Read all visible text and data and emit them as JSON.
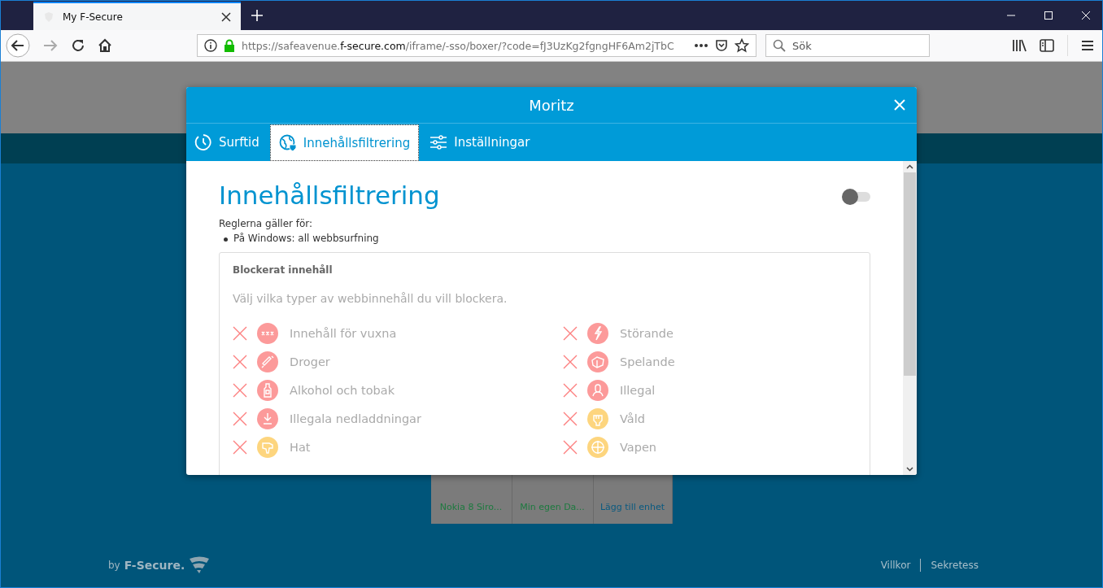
{
  "browser": {
    "tab": {
      "title": "My F-Secure"
    },
    "url": {
      "host_prefix": "https://safeavenue.",
      "host": "f-secure.com",
      "path": "/iframe/-sso/boxer/?code=fJ3UzKg2fgngHF6Am2jTbC"
    },
    "search": {
      "placeholder": "Sök"
    }
  },
  "page": {
    "devices": [
      "Nokia 8 Siro...",
      "Min egen Da...",
      "Lägg till enhet"
    ],
    "footer": {
      "brand_by": "by",
      "brand": "F-Secure.",
      "links": [
        "Villkor",
        "Sekretess"
      ]
    }
  },
  "dialog": {
    "title": "Moritz",
    "tabs": [
      {
        "label": "Surftid",
        "kind": "clock",
        "selected": false
      },
      {
        "label": "Innehållsfiltrering",
        "kind": "globe",
        "selected": true
      },
      {
        "label": "Inställningar",
        "kind": "sliders",
        "selected": false
      }
    ],
    "heading": "Innehållsfiltrering",
    "toggle": {
      "on": false
    },
    "rules_label": "Reglerna gäller för:",
    "rules": [
      "På Windows: all webbsurfning"
    ],
    "panel": {
      "title": "Blockerat innehåll",
      "hint": "Välj vilka typer av webbinnehåll du vill blockera.",
      "categories": [
        {
          "label": "Innehåll för vuxna",
          "kind": "xxx",
          "color": "#fc9a9a",
          "blocked": true
        },
        {
          "label": "Störande",
          "kind": "bolt",
          "color": "#fc9a9a",
          "blocked": true
        },
        {
          "label": "Droger",
          "kind": "syringe",
          "color": "#fc9a9a",
          "blocked": true
        },
        {
          "label": "Spelande",
          "kind": "dice",
          "color": "#fc9a9a",
          "blocked": true
        },
        {
          "label": "Alkohol och tobak",
          "kind": "bottle",
          "color": "#fc9a9a",
          "blocked": true
        },
        {
          "label": "Illegal",
          "kind": "person",
          "color": "#fc9a9a",
          "blocked": true
        },
        {
          "label": "Illegala nedladdningar",
          "kind": "download",
          "color": "#fc9a9a",
          "blocked": true
        },
        {
          "label": "Våld",
          "kind": "fist",
          "color": "#fdd57e",
          "blocked": true
        },
        {
          "label": "Hat",
          "kind": "thumb",
          "color": "#fdd57e",
          "blocked": true
        },
        {
          "label": "Vapen",
          "kind": "crosshair",
          "color": "#fdd57e",
          "blocked": true
        }
      ]
    }
  }
}
